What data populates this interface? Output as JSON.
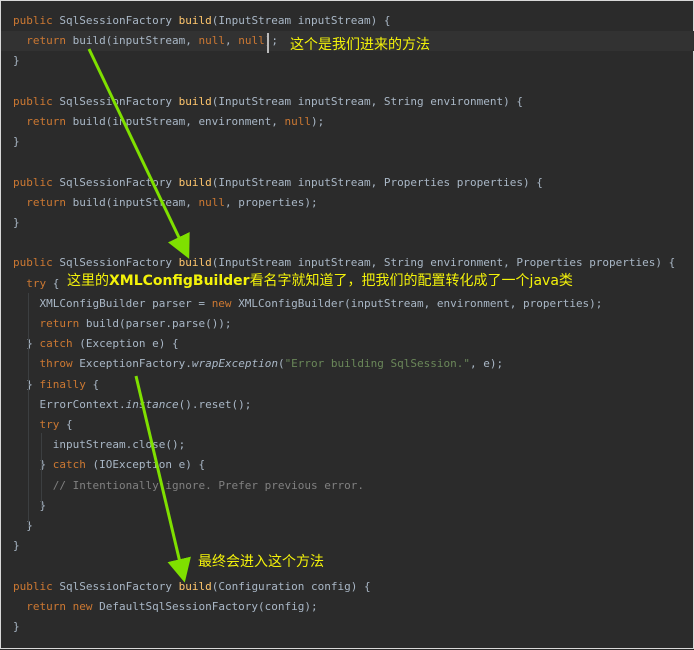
{
  "code_lines": [
    {
      "parts": [
        {
          "t": "public ",
          "c": "kw"
        },
        {
          "t": "SqlSessionFactory ",
          "c": ""
        },
        {
          "t": "build",
          "c": "fn"
        },
        {
          "t": "(InputStream inputStream) {",
          "c": ""
        }
      ]
    },
    {
      "parts": [
        {
          "t": "  ",
          "c": ""
        },
        {
          "t": "return ",
          "c": "kw"
        },
        {
          "t": "build(inputStream, ",
          "c": ""
        },
        {
          "t": "null",
          "c": "kw"
        },
        {
          "t": ", ",
          "c": ""
        },
        {
          "t": "null",
          "c": "kw"
        },
        {
          "t": ");",
          "c": ""
        }
      ],
      "current": true
    },
    {
      "parts": [
        {
          "t": "}",
          "c": ""
        }
      ]
    },
    {
      "parts": []
    },
    {
      "parts": [
        {
          "t": "public ",
          "c": "kw"
        },
        {
          "t": "SqlSessionFactory ",
          "c": ""
        },
        {
          "t": "build",
          "c": "fn"
        },
        {
          "t": "(InputStream inputStream, String environment) {",
          "c": ""
        }
      ]
    },
    {
      "parts": [
        {
          "t": "  ",
          "c": ""
        },
        {
          "t": "return ",
          "c": "kw"
        },
        {
          "t": "build(inputStream, environment, ",
          "c": ""
        },
        {
          "t": "null",
          "c": "kw"
        },
        {
          "t": ");",
          "c": ""
        }
      ]
    },
    {
      "parts": [
        {
          "t": "}",
          "c": ""
        }
      ]
    },
    {
      "parts": []
    },
    {
      "parts": [
        {
          "t": "public ",
          "c": "kw"
        },
        {
          "t": "SqlSessionFactory ",
          "c": ""
        },
        {
          "t": "build",
          "c": "fn"
        },
        {
          "t": "(InputStream inputStream, Properties properties) {",
          "c": ""
        }
      ]
    },
    {
      "parts": [
        {
          "t": "  ",
          "c": ""
        },
        {
          "t": "return ",
          "c": "kw"
        },
        {
          "t": "build(inputStream, ",
          "c": ""
        },
        {
          "t": "null",
          "c": "kw"
        },
        {
          "t": ", properties);",
          "c": ""
        }
      ]
    },
    {
      "parts": [
        {
          "t": "}",
          "c": ""
        }
      ]
    },
    {
      "parts": []
    },
    {
      "parts": [
        {
          "t": "public ",
          "c": "kw"
        },
        {
          "t": "SqlSessionFactory ",
          "c": ""
        },
        {
          "t": "build",
          "c": "fn"
        },
        {
          "t": "(InputStream inputStream, String environment, Properties properties) {",
          "c": ""
        }
      ]
    },
    {
      "parts": [
        {
          "t": "  ",
          "c": ""
        },
        {
          "t": "try ",
          "c": "kw"
        },
        {
          "t": "{",
          "c": ""
        }
      ]
    },
    {
      "parts": [
        {
          "t": "    XMLConfigBuilder parser = ",
          "c": ""
        },
        {
          "t": "new ",
          "c": "kw"
        },
        {
          "t": "XMLConfigBuilder(inputStream, environment, properties);",
          "c": ""
        }
      ]
    },
    {
      "parts": [
        {
          "t": "    ",
          "c": ""
        },
        {
          "t": "return ",
          "c": "kw"
        },
        {
          "t": "build(parser.parse());",
          "c": ""
        }
      ]
    },
    {
      "parts": [
        {
          "t": "  } ",
          "c": ""
        },
        {
          "t": "catch ",
          "c": "kw"
        },
        {
          "t": "(Exception e) {",
          "c": ""
        }
      ]
    },
    {
      "parts": [
        {
          "t": "    ",
          "c": ""
        },
        {
          "t": "throw ",
          "c": "kw"
        },
        {
          "t": "ExceptionFactory.",
          "c": ""
        },
        {
          "t": "wrapException",
          "c": "it"
        },
        {
          "t": "(",
          "c": ""
        },
        {
          "t": "\"Error building SqlSession.\"",
          "c": "str"
        },
        {
          "t": ", e);",
          "c": ""
        }
      ]
    },
    {
      "parts": [
        {
          "t": "  } ",
          "c": ""
        },
        {
          "t": "finally ",
          "c": "kw"
        },
        {
          "t": "{",
          "c": ""
        }
      ]
    },
    {
      "parts": [
        {
          "t": "    ErrorContext.",
          "c": ""
        },
        {
          "t": "instance",
          "c": "it"
        },
        {
          "t": "().reset();",
          "c": ""
        }
      ]
    },
    {
      "parts": [
        {
          "t": "    ",
          "c": ""
        },
        {
          "t": "try ",
          "c": "kw"
        },
        {
          "t": "{",
          "c": ""
        }
      ]
    },
    {
      "parts": [
        {
          "t": "      inputStream.close();",
          "c": ""
        }
      ]
    },
    {
      "parts": [
        {
          "t": "    } ",
          "c": ""
        },
        {
          "t": "catch ",
          "c": "kw"
        },
        {
          "t": "(IOException e) {",
          "c": ""
        }
      ]
    },
    {
      "parts": [
        {
          "t": "      ",
          "c": ""
        },
        {
          "t": "// Intentionally ignore. Prefer previous error.",
          "c": "cmt"
        }
      ]
    },
    {
      "parts": [
        {
          "t": "    }",
          "c": ""
        }
      ]
    },
    {
      "parts": [
        {
          "t": "  }",
          "c": ""
        }
      ]
    },
    {
      "parts": [
        {
          "t": "}",
          "c": ""
        }
      ]
    },
    {
      "parts": []
    },
    {
      "parts": [
        {
          "t": "public ",
          "c": "kw"
        },
        {
          "t": "SqlSessionFactory ",
          "c": ""
        },
        {
          "t": "build",
          "c": "fn"
        },
        {
          "t": "(Configuration config) {",
          "c": ""
        }
      ]
    },
    {
      "parts": [
        {
          "t": "  ",
          "c": ""
        },
        {
          "t": "return new ",
          "c": "kw"
        },
        {
          "t": "DefaultSqlSessionFactory(config);",
          "c": ""
        }
      ]
    },
    {
      "parts": [
        {
          "t": "}",
          "c": ""
        }
      ]
    }
  ],
  "annotations": {
    "note1": "这个是我们进来的方法",
    "note2_prefix": "这里的",
    "note2_strong": "XMLConfigBuilder",
    "note2_suffix": "看名字就知道了，把我们的配置转化成了一个java类",
    "note3": "最终会进入这个方法"
  },
  "colors": {
    "background": "#2b2b2b",
    "keyword": "#cc7832",
    "method": "#ffc66d",
    "string": "#6a8759",
    "comment": "#808080",
    "text": "#a9b7c6",
    "annotation": "#f3f20a",
    "arrow": "#7fe000"
  }
}
